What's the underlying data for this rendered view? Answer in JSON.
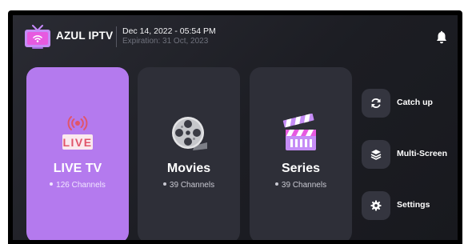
{
  "header": {
    "brand": "AZUL IPTV",
    "datetime": "Dec 14, 2022 - 05:54 PM",
    "expiration": "Expiration: 31 Oct, 2023"
  },
  "cards": [
    {
      "title": "LIVE TV",
      "subtitle": "126 Channels",
      "icon": "live-tv-icon",
      "icon_text": "LIVE"
    },
    {
      "title": "Movies",
      "subtitle": "39 Channels",
      "icon": "film-reel-icon"
    },
    {
      "title": "Series",
      "subtitle": "39 Channels",
      "icon": "clapperboard-icon"
    }
  ],
  "side_menu": [
    {
      "label": "Catch up",
      "icon": "refresh-icon"
    },
    {
      "label": "Multi-Screen",
      "icon": "layers-icon"
    },
    {
      "label": "Settings",
      "icon": "gear-icon"
    }
  ],
  "colors": {
    "accent": "#b47aee",
    "background": "#1f2026",
    "card": "#2e2f38",
    "live_red": "#e0556a"
  }
}
